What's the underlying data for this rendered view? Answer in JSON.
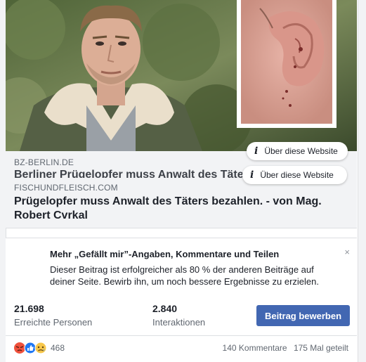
{
  "link_back": {
    "domain": "BZ-BERLIN.DE",
    "title": "Berliner Prügelopfer muss Anwalt des Täters bezahlen"
  },
  "link_front": {
    "domain": "FISCHUNDFLEISCH.COM",
    "title": "Prügelopfer muss Anwalt des Täters bezahlen. - von Mag. Robert Cvrkal"
  },
  "info_pills": [
    {
      "icon": "i",
      "label": "Über diese Website"
    },
    {
      "icon": "i",
      "label": "Über diese Website"
    }
  ],
  "promo": {
    "title": "Mehr „Gefällt mir”-Angaben, Kommentare und Teilen",
    "text": "Dieser Beitrag ist erfolgreicher als 80 % der anderen Beiträge auf deiner Seite. Bewirb ihn, um noch bessere Ergebnisse zu erzielen.",
    "close": "×"
  },
  "stats": {
    "reach_value": "21.698",
    "reach_label": "Erreichte Personen",
    "interactions_value": "2.840",
    "interactions_label": "Interaktionen",
    "promote_button": "Beitrag bewerben"
  },
  "reactions": {
    "icons": [
      "angry-icon",
      "like-icon",
      "sad-icon"
    ],
    "count": "468",
    "comments": "140 Kommentare",
    "shares": "175 Mal geteilt"
  },
  "colors": {
    "brand_blue": "#4267b2",
    "like_blue": "#2078f4",
    "angry_red": "#f0513c",
    "sad_yellow": "#f7c74b",
    "muted_text": "#606770"
  }
}
